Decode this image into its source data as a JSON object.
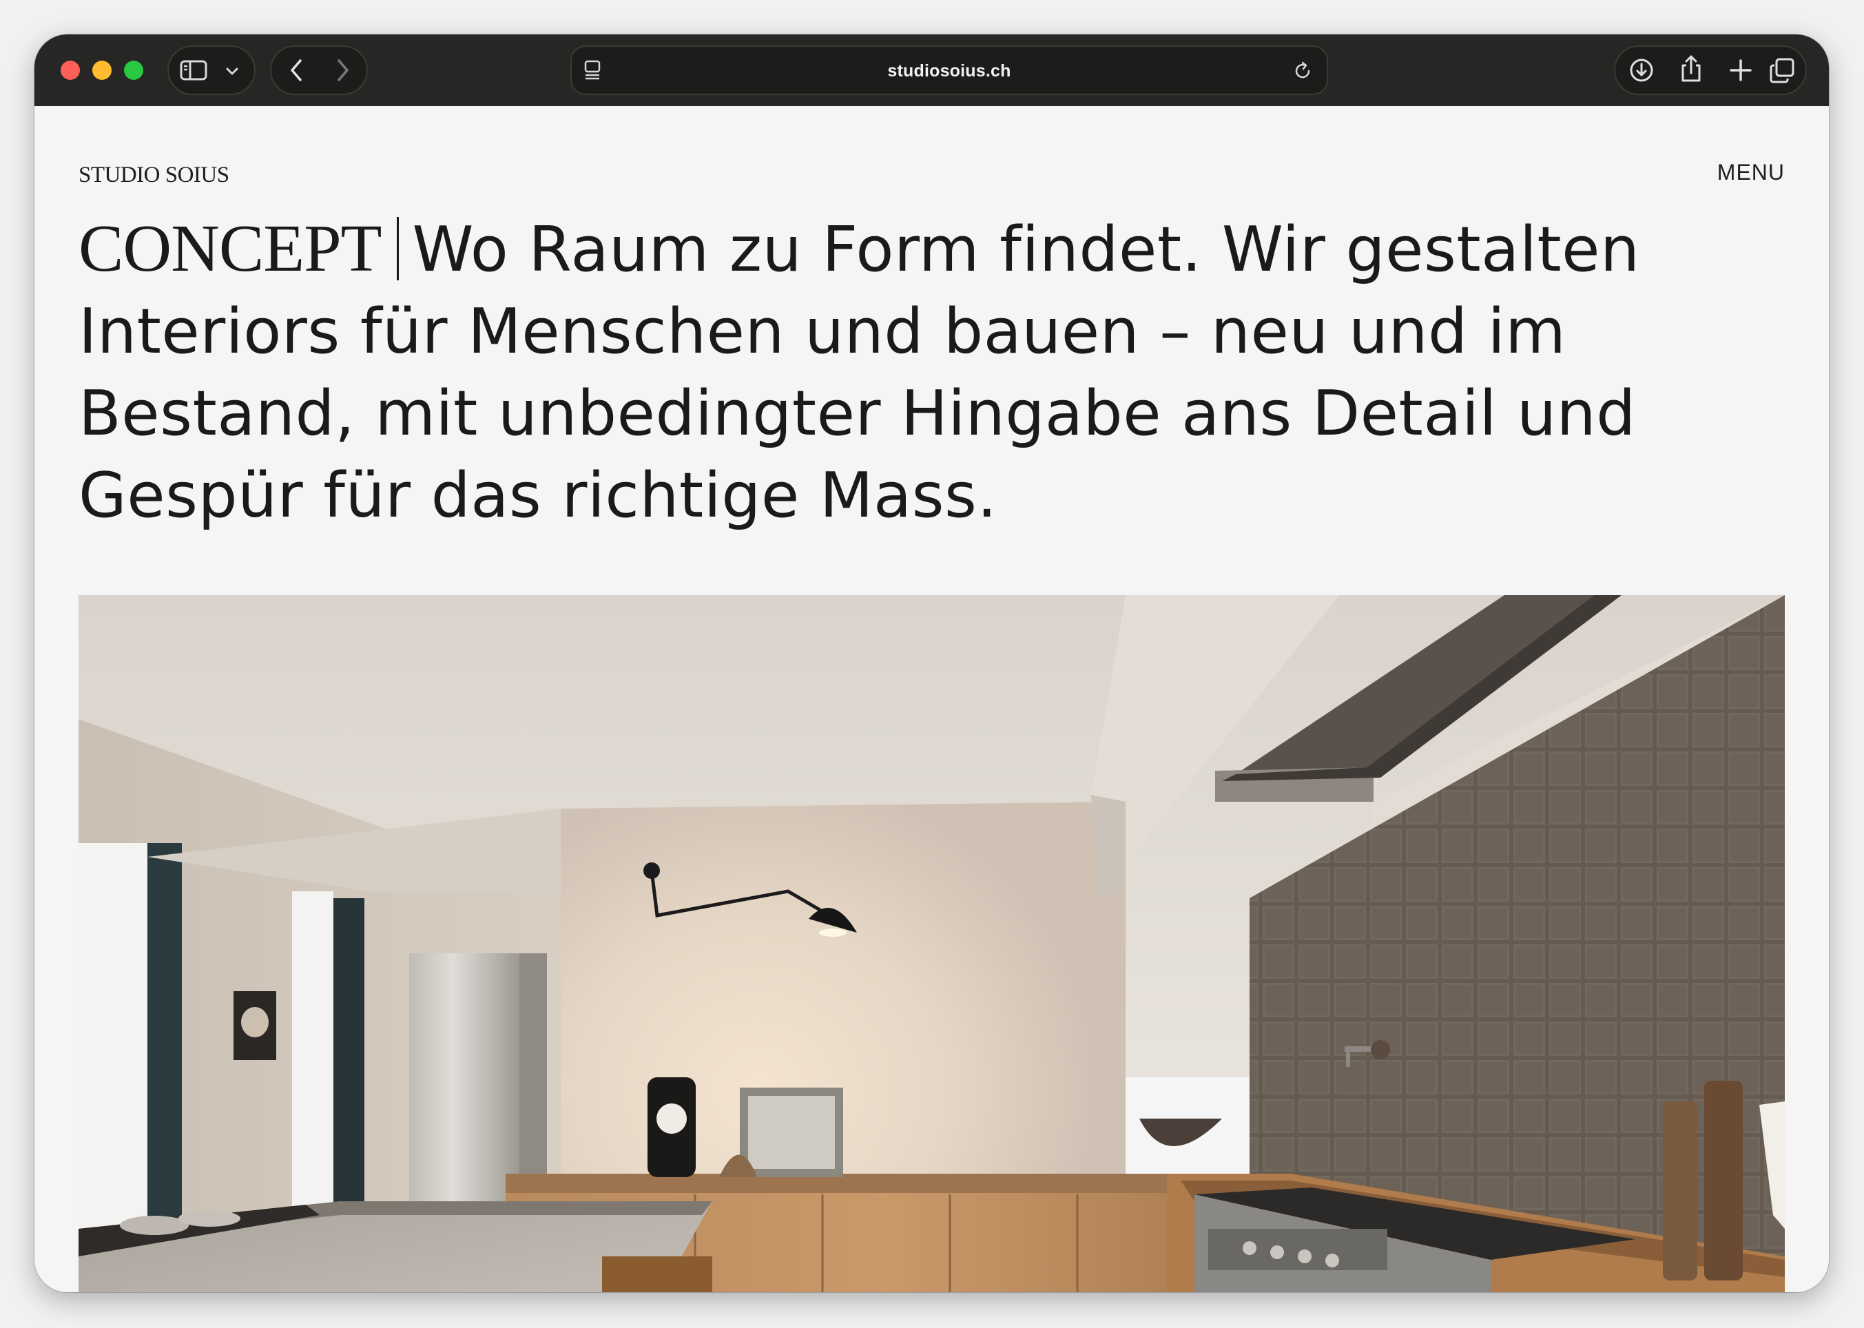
{
  "browser": {
    "url": "studiosoius.ch",
    "icons": {
      "sidebar": "sidebar-icon",
      "chevron": "chevron-down-icon",
      "back": "back-icon",
      "forward": "forward-icon",
      "page_settings": "page-settings-icon",
      "reload": "reload-icon",
      "download": "download-icon",
      "share": "share-icon",
      "new_tab": "plus-icon",
      "tabs": "tab-overview-icon"
    },
    "traffic_lights": {
      "close": "#fe5f57",
      "minimize": "#febc2e",
      "zoom": "#28c840"
    }
  },
  "site": {
    "brand": "STUDIO SOIUS",
    "menu_label": "MENU",
    "headline": {
      "lead": "CONCEPT",
      "text": "Wo Raum zu Form findet. Wir gestalten Interiors für Menschen und bauen – neu und im Bestand, mit unbedingter Hingabe ans Detail und Gespür für das richtige Mass."
    },
    "hero_image": {
      "subject": "kitchen-interior-photo"
    }
  },
  "colors": {
    "toolbar": "#262624",
    "page_background": "#f5f5f5",
    "text": "#1a1a1a"
  }
}
